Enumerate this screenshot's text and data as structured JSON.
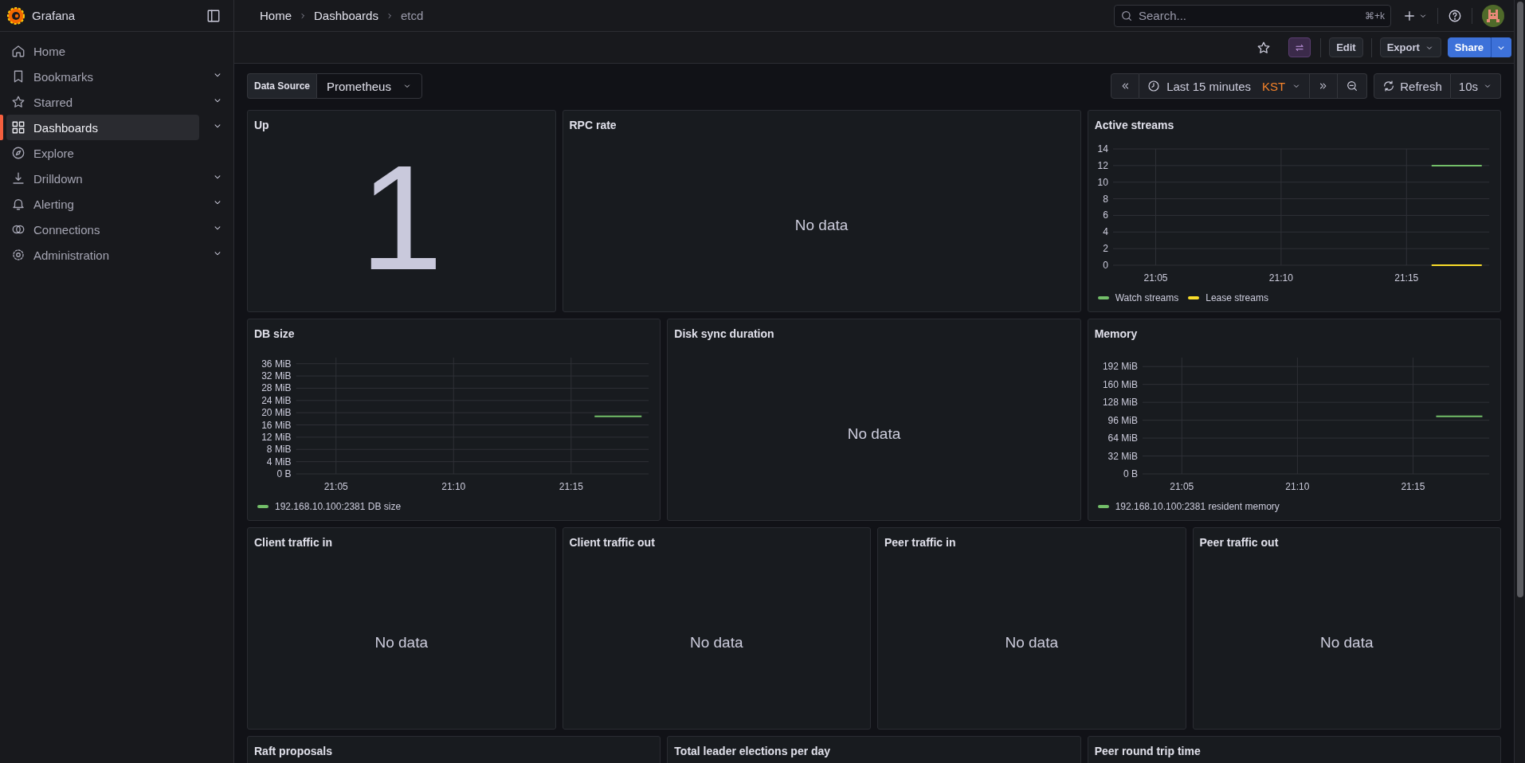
{
  "sidebar": {
    "brand": "Grafana",
    "items": [
      {
        "label": "Home",
        "expandable": false,
        "selected": false
      },
      {
        "label": "Bookmarks",
        "expandable": true,
        "selected": false
      },
      {
        "label": "Starred",
        "expandable": true,
        "selected": false
      },
      {
        "label": "Dashboards",
        "expandable": true,
        "selected": true
      },
      {
        "label": "Explore",
        "expandable": false,
        "selected": false
      },
      {
        "label": "Drilldown",
        "expandable": true,
        "selected": false
      },
      {
        "label": "Alerting",
        "expandable": true,
        "selected": false
      },
      {
        "label": "Connections",
        "expandable": true,
        "selected": false
      },
      {
        "label": "Administration",
        "expandable": true,
        "selected": false
      }
    ]
  },
  "breadcrumbs": [
    "Home",
    "Dashboards",
    "etcd"
  ],
  "search": {
    "placeholder": "Search...",
    "shortcut": "⌘+k"
  },
  "toolbar": {
    "buttons": [
      {
        "label": "Edit",
        "kind": "plain"
      },
      {
        "label": "Export",
        "kind": "menu"
      },
      {
        "label": "Share",
        "kind": "primary"
      }
    ]
  },
  "variables": [
    {
      "label": "Data Source",
      "value": "Prometheus"
    }
  ],
  "time_range": {
    "label": "Last 15 minutes",
    "timezone": "KST"
  },
  "refresh": {
    "label": "Refresh",
    "interval": "10s"
  },
  "panels": [
    {
      "title": "Up",
      "kind": "stat",
      "value": "1"
    },
    {
      "title": "RPC rate",
      "kind": "nodata",
      "message": "No data"
    },
    {
      "title": "Active streams",
      "kind": "timeseries",
      "chart_data": {
        "type": "line",
        "grid": true,
        "categories": [
          null,
          null,
          "21:05",
          null,
          null,
          null,
          null,
          "21:10",
          null,
          null,
          null,
          null,
          "21:15",
          null,
          null,
          null
        ],
        "ylim": [
          0,
          14
        ],
        "yticks": [
          0,
          2,
          4,
          6,
          8,
          10,
          12,
          14
        ],
        "series": [
          {
            "name": "Watch streams",
            "color": "#73bf69",
            "values": [
              null,
              null,
              null,
              null,
              null,
              null,
              null,
              null,
              null,
              null,
              null,
              null,
              null,
              12,
              12,
              12
            ]
          },
          {
            "name": "Lease streams",
            "color": "#fade2a",
            "values": [
              null,
              null,
              null,
              null,
              null,
              null,
              null,
              null,
              null,
              null,
              null,
              null,
              null,
              0,
              0,
              0
            ]
          }
        ]
      }
    },
    {
      "title": "DB size",
      "kind": "timeseries",
      "chart_data": {
        "type": "line",
        "grid": true,
        "categories": [
          null,
          null,
          "21:05",
          null,
          null,
          null,
          null,
          "21:10",
          null,
          null,
          null,
          null,
          "21:15",
          null,
          null,
          null
        ],
        "ylim": [
          0,
          38
        ],
        "yticks": [
          {
            "value": 0,
            "label": "0 B"
          },
          {
            "value": 4,
            "label": "4 MiB"
          },
          {
            "value": 8,
            "label": "8 MiB"
          },
          {
            "value": 12,
            "label": "12 MiB"
          },
          {
            "value": 16,
            "label": "16 MiB"
          },
          {
            "value": 20,
            "label": "20 MiB"
          },
          {
            "value": 24,
            "label": "24 MiB"
          },
          {
            "value": 28,
            "label": "28 MiB"
          },
          {
            "value": 32,
            "label": "32 MiB"
          },
          {
            "value": 36,
            "label": "36 MiB"
          }
        ],
        "series": [
          {
            "name": "192.168.10.100:2381 DB size",
            "color": "#73bf69",
            "values": [
              null,
              null,
              null,
              null,
              null,
              null,
              null,
              null,
              null,
              null,
              null,
              null,
              null,
              18.8,
              18.8,
              18.8
            ]
          }
        ]
      }
    },
    {
      "title": "Disk sync duration",
      "kind": "nodata",
      "message": "No data"
    },
    {
      "title": "Memory",
      "kind": "timeseries",
      "chart_data": {
        "type": "line",
        "grid": true,
        "categories": [
          null,
          null,
          "21:05",
          null,
          null,
          null,
          null,
          "21:10",
          null,
          null,
          null,
          null,
          "21:15",
          null,
          null,
          null
        ],
        "ylim": [
          0,
          208
        ],
        "yticks": [
          {
            "value": 0,
            "label": "0 B"
          },
          {
            "value": 32,
            "label": "32 MiB"
          },
          {
            "value": 64,
            "label": "64 MiB"
          },
          {
            "value": 96,
            "label": "96 MiB"
          },
          {
            "value": 128,
            "label": "128 MiB"
          },
          {
            "value": 160,
            "label": "160 MiB"
          },
          {
            "value": 192,
            "label": "192 MiB"
          }
        ],
        "series": [
          {
            "name": "192.168.10.100:2381 resident memory",
            "color": "#73bf69",
            "values": [
              null,
              null,
              null,
              null,
              null,
              null,
              null,
              null,
              null,
              null,
              null,
              null,
              null,
              103,
              103,
              103
            ]
          }
        ]
      }
    },
    {
      "title": "Client traffic in",
      "kind": "nodata",
      "message": "No data"
    },
    {
      "title": "Client traffic out",
      "kind": "nodata",
      "message": "No data"
    },
    {
      "title": "Peer traffic in",
      "kind": "nodata",
      "message": "No data"
    },
    {
      "title": "Peer traffic out",
      "kind": "nodata",
      "message": "No data"
    },
    {
      "title": "Raft proposals",
      "kind": "clipped"
    },
    {
      "title": "Total leader elections per day",
      "kind": "clipped"
    },
    {
      "title": "Peer round trip time",
      "kind": "clipped"
    }
  ]
}
